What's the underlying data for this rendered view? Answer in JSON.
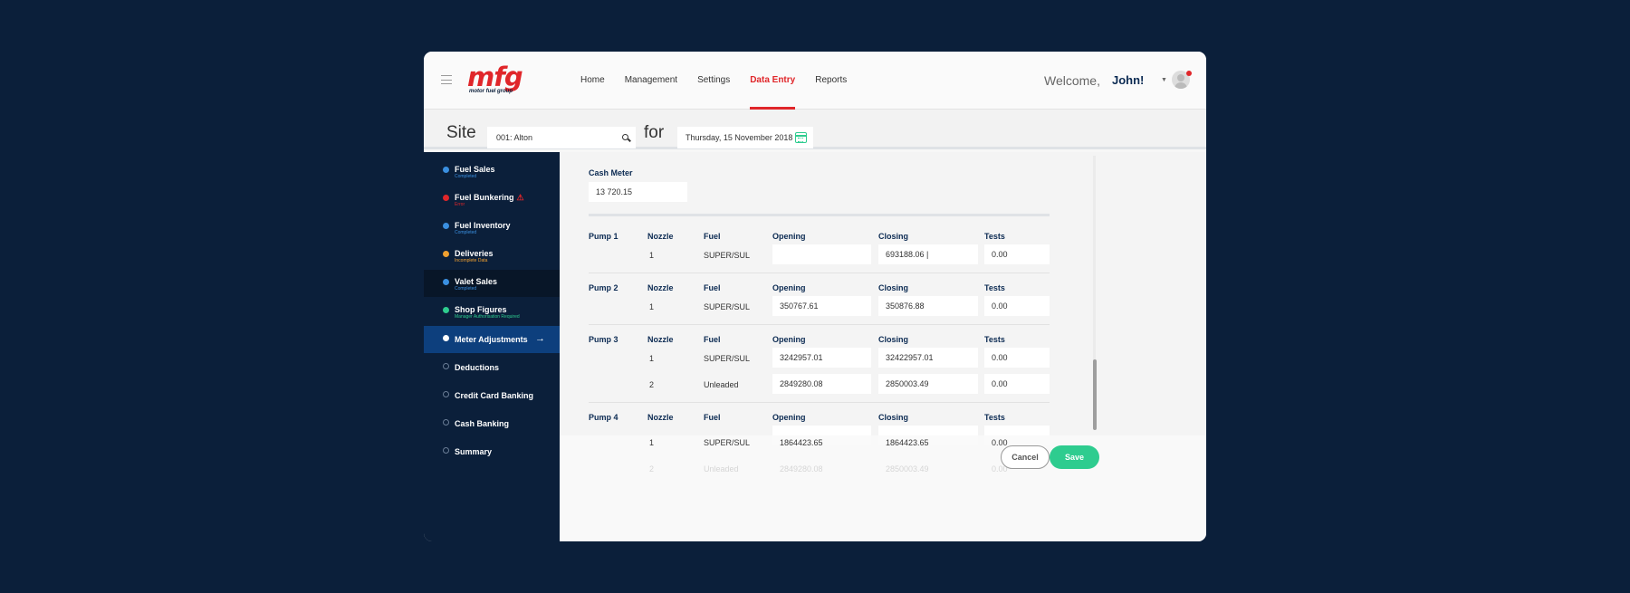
{
  "brand": {
    "logo_text": "mfg",
    "logo_subtext": "motor fuel group",
    "color": "#e0262a"
  },
  "nav": {
    "items": [
      {
        "label": "Home",
        "active": false
      },
      {
        "label": "Management",
        "active": false
      },
      {
        "label": "Settings",
        "active": false
      },
      {
        "label": "Data Entry",
        "active": true
      },
      {
        "label": "Reports",
        "active": false
      }
    ]
  },
  "user": {
    "welcome": "Welcome,",
    "name": "John!",
    "avatar_icon": "user-avatar-icon",
    "notification_color": "#e0262a"
  },
  "site": {
    "label": "Site",
    "value": "001: Alton",
    "for_label": "for",
    "date": "Thursday, 15 November 2018"
  },
  "sidebar": {
    "items": [
      {
        "label": "Fuel Sales",
        "status": "Completed",
        "dot_color": "#3a8fe0",
        "status_color": "#3a8fe0"
      },
      {
        "label": "Fuel Bunkering",
        "status": "Error",
        "dot_color": "#e0262a",
        "status_color": "#e0262a",
        "warning_icon": "warning-icon"
      },
      {
        "label": "Fuel Inventory",
        "status": "Completed",
        "dot_color": "#3a8fe0",
        "status_color": "#3a8fe0"
      },
      {
        "label": "Deliveries",
        "status": "Incomplete Data",
        "dot_color": "#f0a030",
        "status_color": "#f0a030"
      },
      {
        "label": "Valet Sales",
        "status": "Completed",
        "dot_color": "#3a8fe0",
        "status_color": "#3a8fe0"
      },
      {
        "label": "Shop Figures",
        "status": "Manager Authorisation Required",
        "dot_color": "#2ecc8f",
        "status_color": "#2ecc8f"
      },
      {
        "label": "Meter Adjustments",
        "status": "",
        "dot_color": "#ffffff",
        "active": true
      },
      {
        "label": "Deductions",
        "status": ""
      },
      {
        "label": "Credit Card Banking",
        "status": ""
      },
      {
        "label": "Cash Banking",
        "status": ""
      },
      {
        "label": "Summary",
        "status": ""
      }
    ]
  },
  "cash_meter": {
    "label": "Cash Meter",
    "value": "13 720.15"
  },
  "columns": {
    "nozzle": "Nozzle",
    "fuel": "Fuel",
    "opening": "Opening",
    "closing": "Closing",
    "tests": "Tests"
  },
  "pumps": [
    {
      "label": "Pump 1",
      "rows": [
        {
          "nozzle": "1",
          "fuel": "SUPER/SUL",
          "opening": "",
          "closing": "693188.06 |",
          "tests": "0.00"
        }
      ]
    },
    {
      "label": "Pump 2",
      "rows": [
        {
          "nozzle": "1",
          "fuel": "SUPER/SUL",
          "opening": "350767.61",
          "closing": "350876.88",
          "tests": "0.00"
        }
      ]
    },
    {
      "label": "Pump 3",
      "rows": [
        {
          "nozzle": "1",
          "fuel": "SUPER/SUL",
          "opening": "3242957.01",
          "closing": "32422957.01",
          "tests": "0.00"
        },
        {
          "nozzle": "2",
          "fuel": "Unleaded",
          "opening": "2849280.08",
          "closing": "2850003.49",
          "tests": "0.00"
        }
      ]
    },
    {
      "label": "Pump 4",
      "rows": [
        {
          "nozzle": "1",
          "fuel": "SUPER/SUL",
          "opening": "1864423.65",
          "closing": "1864423.65",
          "tests": "0.00"
        },
        {
          "nozzle": "2",
          "fuel": "Unleaded",
          "opening": "2849280.08",
          "closing": "2850003.49",
          "tests": "0.00"
        }
      ]
    }
  ],
  "actions": {
    "cancel": "Cancel",
    "save": "Save",
    "save_color": "#2ecc8f"
  }
}
